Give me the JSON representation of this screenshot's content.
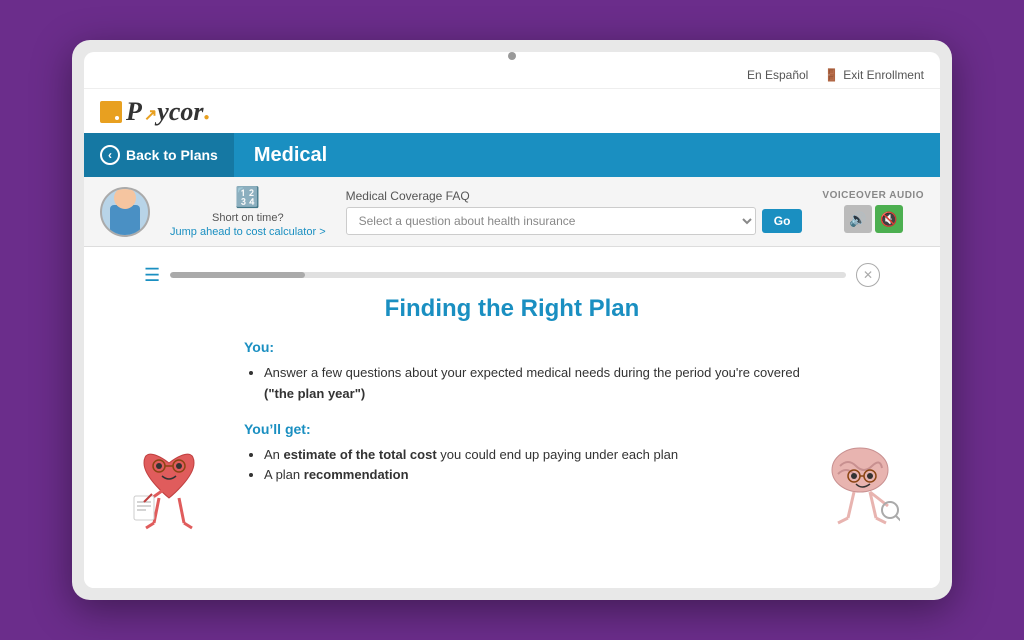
{
  "device": {
    "camera_label": "camera"
  },
  "utility_bar": {
    "language": "En Español",
    "exit_label": "Exit Enrollment",
    "exit_icon": "door-icon"
  },
  "header": {
    "logo_text": "Paycor",
    "logo_aria": "Paycor logo"
  },
  "nav": {
    "back_label": "Back to Plans",
    "page_title": "Medical"
  },
  "info_bar": {
    "shortcut_title": "Short on time?",
    "shortcut_link": "Jump ahead to cost calculator >",
    "faq_label": "Medical Coverage FAQ",
    "faq_placeholder": "Select a question about health insurance",
    "go_button": "Go",
    "voiceover_label": "VOICEOVER AUDIO"
  },
  "content": {
    "main_title": "Finding the Right Plan",
    "you_label": "You:",
    "you_bullets": [
      "Answer a few questions about your expected medical needs during the period you’re covered (“the plan year”)"
    ],
    "youll_get_label": "You’ll get:",
    "youll_get_bullets": [
      "An estimate of the total cost you could end up paying under each plan",
      "A plan recommendation"
    ],
    "progress_percent": 20,
    "close_icon": "close-icon",
    "menu_icon": "hamburger-menu-icon"
  }
}
